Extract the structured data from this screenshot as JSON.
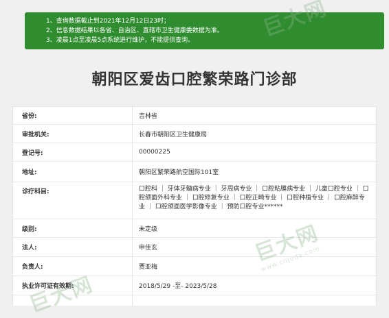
{
  "notice": {
    "lines": [
      "1、查询数据截止到2021年12月12日23时；",
      "2、信息数据结果以各省、自治区、直辖市卫生健康委数据为准。",
      "3、凌晨1点至凌晨5点系统进行维护，不能提供查询。"
    ],
    "background_color": "#2f8c2f"
  },
  "page_title": "朝阳区爱齿口腔繁荣路门诊部",
  "fields": [
    {
      "label": "省份:",
      "value": "吉林省"
    },
    {
      "label": "审批机关:",
      "value": "长春市朝阳区卫生健康局"
    },
    {
      "label": "登记号:",
      "value": "00000225"
    },
    {
      "label": "地址:",
      "value": "朝阳区繁荣路航空国际101室"
    },
    {
      "label": "诊疗科目:",
      "value": "口腔科 ｜ 牙体牙髓病专业 ｜ 牙周病专业 ｜ 口腔粘膜病专业 ｜ 儿童口腔专业 ｜ 口腔颌面外科专业 ｜ 口腔修复专业 ｜ 口腔正畸专业 ｜ 口腔种植专业 ｜ 口腔麻醉专业 ｜ 口腔颌面医学影像专业 ｜ 预防口腔专业******"
    },
    {
      "label": "级别:",
      "value": "未定级"
    },
    {
      "label": "法人:",
      "value": "申佳玄"
    },
    {
      "label": "负责人:",
      "value": "贾亚梅"
    },
    {
      "label": "执业许可证有效期:",
      "value": "2018/5/29 -至- 2023/5/28"
    }
  ],
  "watermark": {
    "text": "巨大网",
    "url_text": "www.cnjuda.com"
  }
}
